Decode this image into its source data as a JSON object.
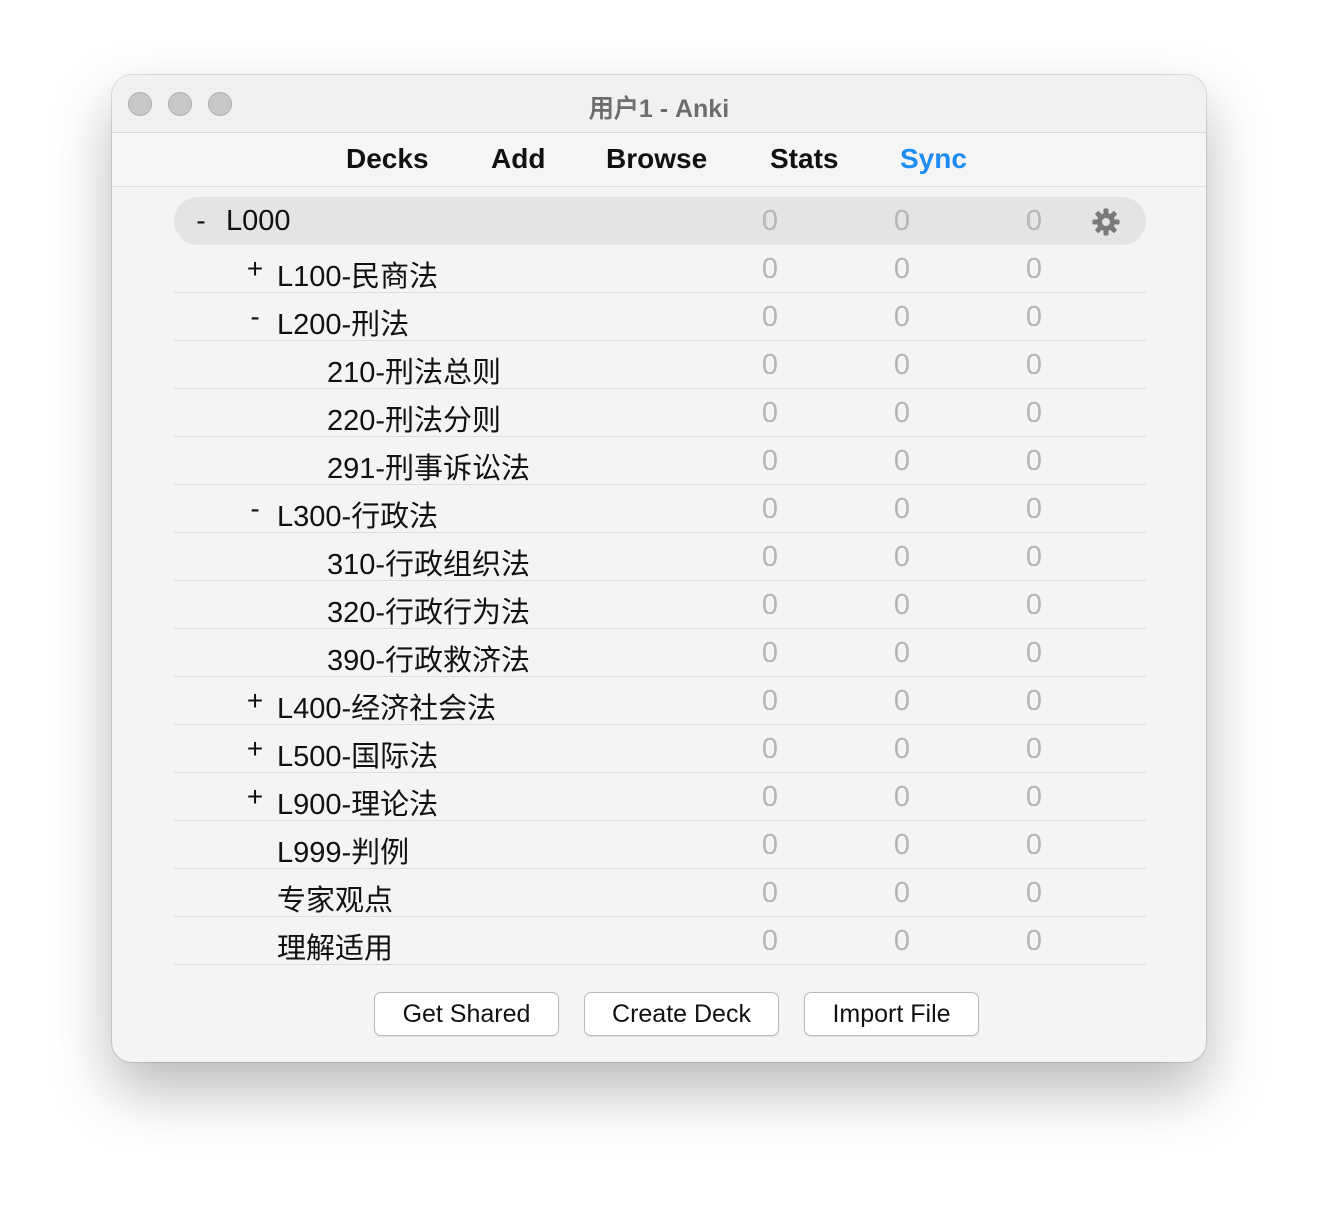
{
  "window": {
    "title": "用户1 - Anki"
  },
  "toolbar": {
    "items": [
      {
        "label": "Decks"
      },
      {
        "label": "Add"
      },
      {
        "label": "Browse"
      },
      {
        "label": "Stats"
      },
      {
        "label": "Sync",
        "accent": "#1e8cf0"
      }
    ]
  },
  "decks": [
    {
      "toggle": "-",
      "name": "L000",
      "counts": [
        "0",
        "0",
        "0"
      ],
      "current": true,
      "icon": "gear-icon"
    },
    {
      "toggle": "+",
      "name": "L100-民商法",
      "counts": [
        "0",
        "0",
        "0"
      ]
    },
    {
      "toggle": "-",
      "name": "L200-刑法",
      "counts": [
        "0",
        "0",
        "0"
      ]
    },
    {
      "toggle": "",
      "name": "210-刑法总则",
      "counts": [
        "0",
        "0",
        "0"
      ]
    },
    {
      "toggle": "",
      "name": "220-刑法分则",
      "counts": [
        "0",
        "0",
        "0"
      ]
    },
    {
      "toggle": "",
      "name": "291-刑事诉讼法",
      "counts": [
        "0",
        "0",
        "0"
      ]
    },
    {
      "toggle": "-",
      "name": "L300-行政法",
      "counts": [
        "0",
        "0",
        "0"
      ]
    },
    {
      "toggle": "",
      "name": "310-行政组织法",
      "counts": [
        "0",
        "0",
        "0"
      ]
    },
    {
      "toggle": "",
      "name": "320-行政行为法",
      "counts": [
        "0",
        "0",
        "0"
      ]
    },
    {
      "toggle": "",
      "name": "390-行政救济法",
      "counts": [
        "0",
        "0",
        "0"
      ]
    },
    {
      "toggle": "+",
      "name": "L400-经济社会法",
      "counts": [
        "0",
        "0",
        "0"
      ]
    },
    {
      "toggle": "+",
      "name": "L500-国际法",
      "counts": [
        "0",
        "0",
        "0"
      ]
    },
    {
      "toggle": "+",
      "name": "L900-理论法",
      "counts": [
        "0",
        "0",
        "0"
      ]
    },
    {
      "toggle": "",
      "name": "L999-判例",
      "counts": [
        "0",
        "0",
        "0"
      ]
    },
    {
      "toggle": "",
      "name": "专家观点",
      "counts": [
        "0",
        "0",
        "0"
      ]
    },
    {
      "toggle": "",
      "name": "理解适用",
      "counts": [
        "0",
        "0",
        "0"
      ]
    }
  ],
  "buttons": {
    "get_shared": "Get Shared",
    "create_deck": "Create Deck",
    "import_file": "Import File"
  },
  "colors": {
    "accent": "#1e8cf0",
    "count_zero": "#b5b5b5"
  }
}
